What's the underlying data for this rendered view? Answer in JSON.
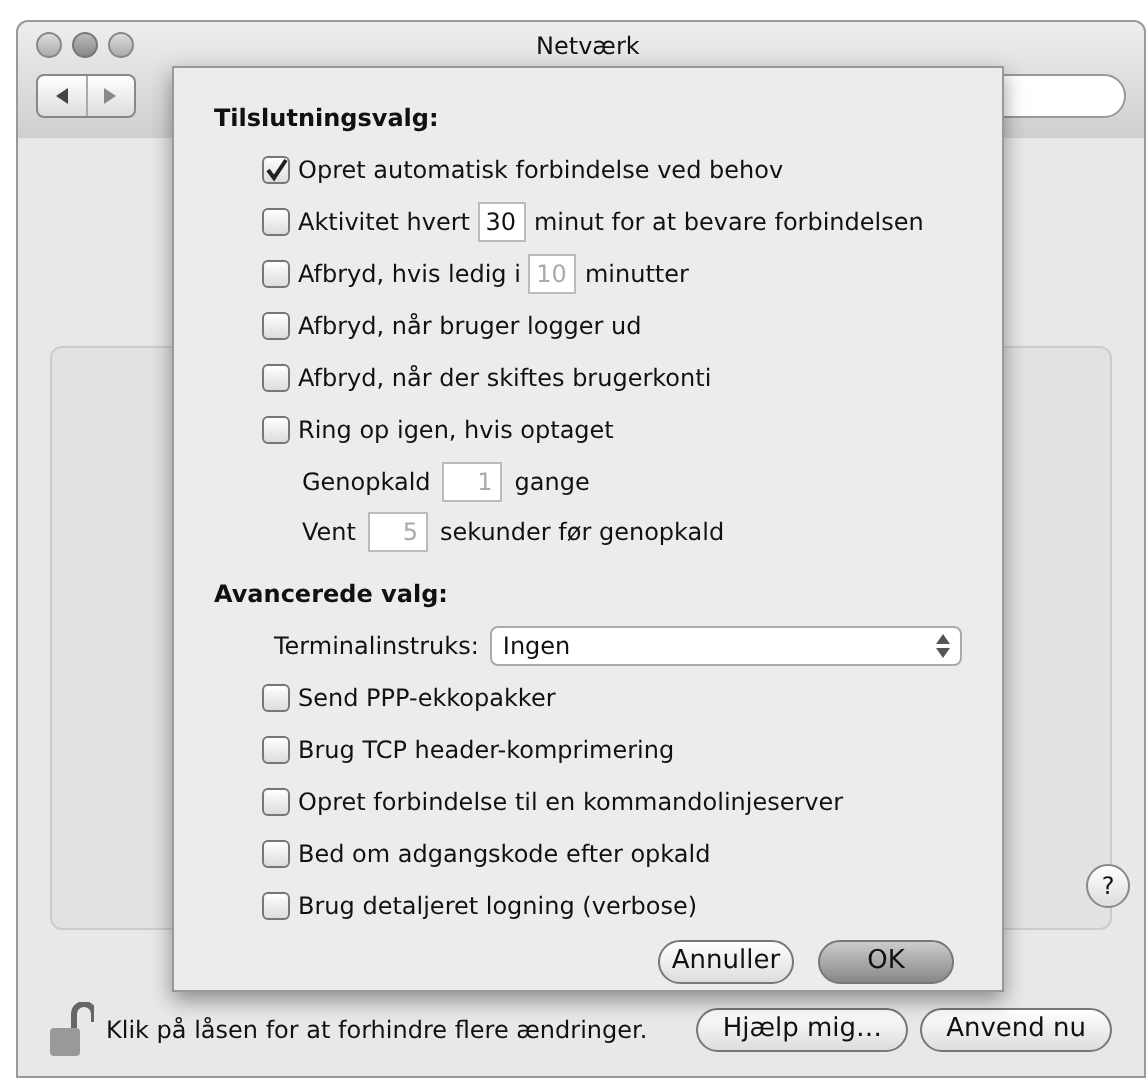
{
  "window": {
    "title": "Netværk"
  },
  "sheet": {
    "connection_options": {
      "heading": "Tilslutningsvalg:",
      "items": [
        {
          "kind": "check",
          "label": "Opret automatisk forbindelse ved behov",
          "checked": true
        },
        {
          "kind": "check_field",
          "before": "Aktivitet hvert",
          "value": "30",
          "after": "minut for at bevare forbindelsen",
          "checked": false,
          "disabled": false
        },
        {
          "kind": "check_field",
          "before": "Afbryd, hvis ledig i",
          "value": "10",
          "after": "minutter",
          "checked": false,
          "disabled": true
        },
        {
          "kind": "check",
          "label": "Afbryd, når bruger logger ud",
          "checked": false
        },
        {
          "kind": "check",
          "label": "Afbryd, når der skiftes brugerkonti",
          "checked": false
        },
        {
          "kind": "check",
          "label": "Ring op igen, hvis optaget",
          "checked": false
        },
        {
          "kind": "field",
          "before": "Genopkald",
          "value": "1",
          "after": "gange",
          "disabled": true
        },
        {
          "kind": "field",
          "before": "Vent",
          "value": "5",
          "after": "sekunder før genopkald",
          "disabled": true
        }
      ]
    },
    "advanced": {
      "heading": "Avancerede valg:",
      "terminal": {
        "label": "Terminalinstruks:",
        "value": "Ingen"
      },
      "items": [
        {
          "kind": "check",
          "label": "Send PPP-ekkopakker",
          "checked": false
        },
        {
          "kind": "check",
          "label": "Brug TCP header-komprimering",
          "checked": false
        },
        {
          "kind": "check",
          "label": "Opret forbindelse til en kommandolinjeserver",
          "checked": false
        },
        {
          "kind": "check",
          "label": "Bed om adgangskode efter opkald",
          "checked": false
        },
        {
          "kind": "check",
          "label": "Brug detaljeret logning (verbose)",
          "checked": false
        }
      ]
    },
    "buttons": [
      {
        "label": "Annuller",
        "default": false
      },
      {
        "label": "OK",
        "default": true
      }
    ]
  },
  "help_button": "?",
  "footer": {
    "lock_text": "Klik på låsen for at forhindre flere ændringer.",
    "buttons": [
      "Hjælp mig…",
      "Anvend nu"
    ]
  }
}
